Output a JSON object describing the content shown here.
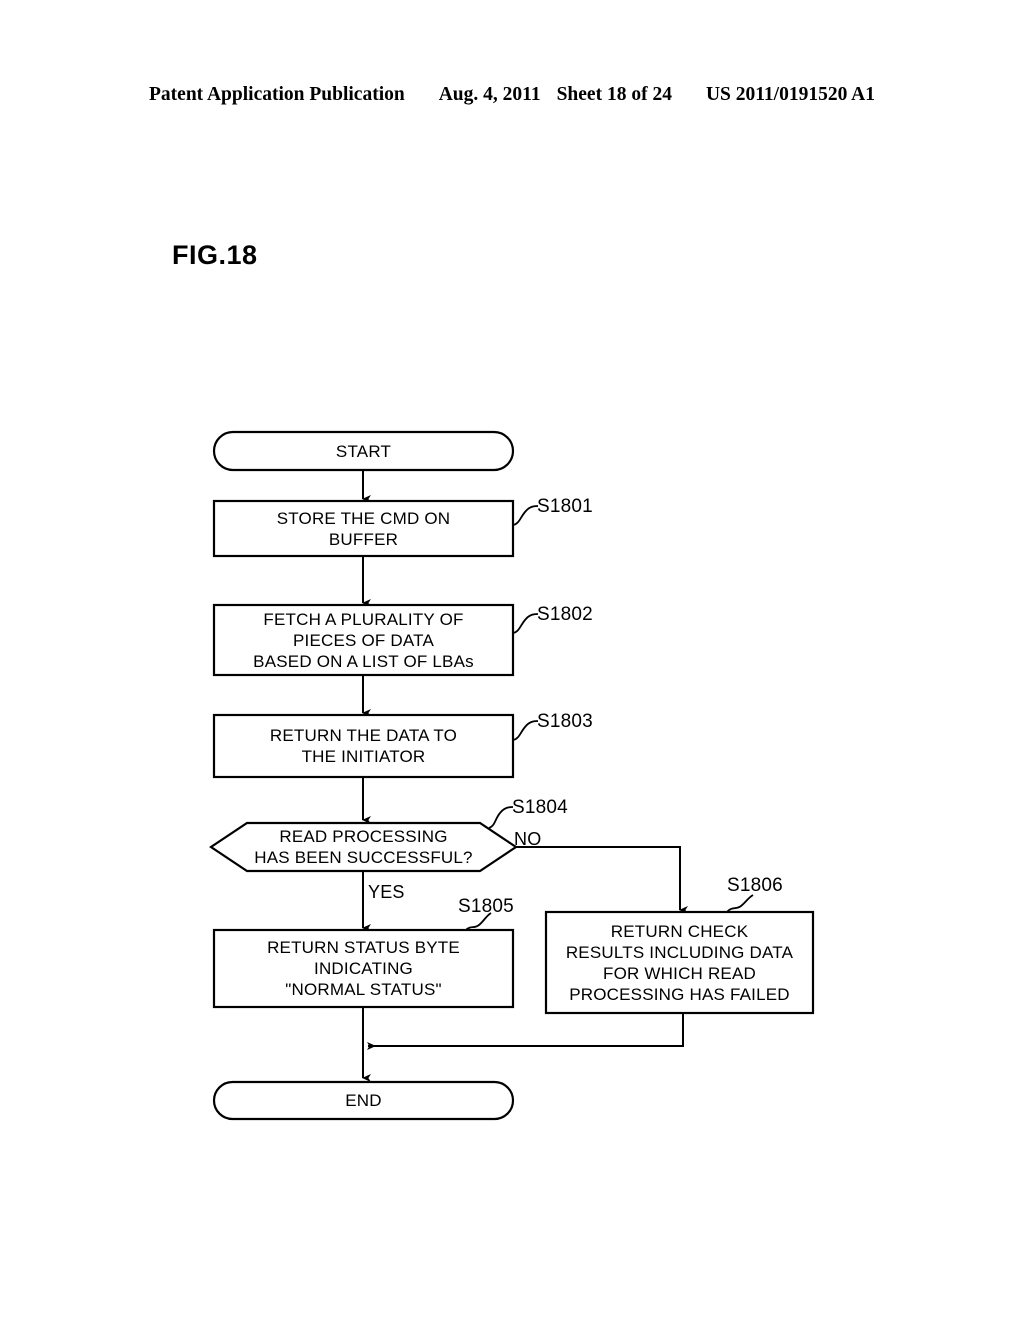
{
  "header": {
    "publication": "Patent Application Publication",
    "date": "Aug. 4, 2011",
    "sheet": "Sheet 18 of 24",
    "patent_number": "US 2011/0191520 A1"
  },
  "figure": {
    "label": "FIG.18"
  },
  "flowchart": {
    "start": {
      "text": "START"
    },
    "end": {
      "text": "END"
    },
    "steps": [
      {
        "id": "S1801",
        "lines": [
          "STORE THE CMD ON",
          "BUFFER"
        ]
      },
      {
        "id": "S1802",
        "lines": [
          "FETCH A PLURALITY OF",
          "PIECES OF DATA",
          "BASED ON A LIST OF LBAs"
        ]
      },
      {
        "id": "S1803",
        "lines": [
          "RETURN THE DATA TO",
          "THE INITIATOR"
        ]
      },
      {
        "id": "S1804",
        "lines": [
          "READ PROCESSING",
          "HAS BEEN SUCCESSFUL?"
        ]
      },
      {
        "id": "S1805",
        "lines": [
          "RETURN STATUS BYTE",
          "INDICATING",
          "\"NORMAL STATUS\""
        ]
      },
      {
        "id": "S1806",
        "lines": [
          "RETURN CHECK",
          "RESULTS INCLUDING DATA",
          "FOR WHICH READ",
          "PROCESSING HAS FAILED"
        ]
      }
    ],
    "branches": {
      "yes": "YES",
      "no": "NO"
    },
    "colors": {
      "stroke": "#000000",
      "background": "#ffffff",
      "text": "#000000"
    }
  }
}
